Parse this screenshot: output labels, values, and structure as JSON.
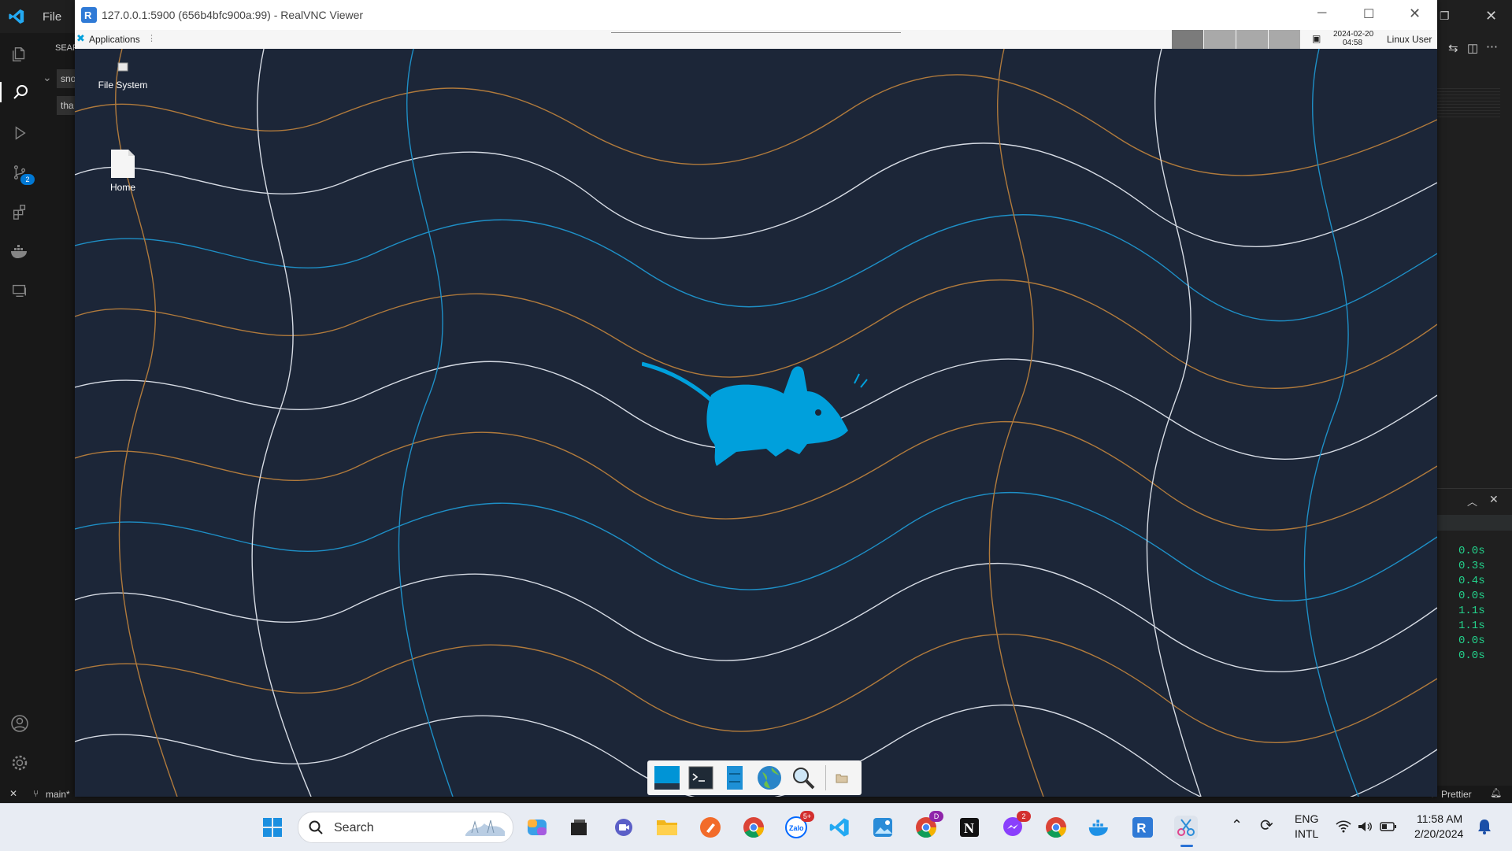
{
  "vscode": {
    "menu_file": "File",
    "sidebar_header": "SEAR",
    "sidebar_item1": "sno",
    "sidebar_item2": "tha",
    "source_control_badge": "2",
    "status": {
      "branch": "main*",
      "prettier": "Prettier"
    },
    "terminal_timings": [
      "0.0s",
      "0.3s",
      "0.4s",
      "0.0s",
      "1.1s",
      "1.1s",
      "0.0s",
      "0.0s"
    ]
  },
  "vnc": {
    "title": "127.0.0.1:5900 (656b4bfc900a:99) - RealVNC Viewer",
    "panel": {
      "applications_label": "Applications",
      "clock_date": "2024-02-20",
      "clock_time": "04:58",
      "user": "Linux User"
    },
    "desktop_icons": [
      {
        "label": "File System",
        "icon": "drive-icon"
      },
      {
        "label": "Home",
        "icon": "home-folder-icon"
      }
    ],
    "dock_items": [
      "show-desktop-icon",
      "terminal-icon",
      "file-manager-icon",
      "web-browser-icon",
      "app-finder-icon",
      "folder-icon"
    ]
  },
  "taskbar": {
    "search_placeholder": "Search",
    "language_line1": "ENG",
    "language_line2": "INTL",
    "time": "11:58 AM",
    "date": "2/20/2024",
    "zalo_badge": "5+",
    "chrome_badge": "D",
    "messenger_badge": "2"
  },
  "colors": {
    "xfce_blue": "#00a0dc",
    "desktop_bg": "#1c2638",
    "vscode_blue": "#23a9f2",
    "terminal_green": "#23d18b"
  }
}
